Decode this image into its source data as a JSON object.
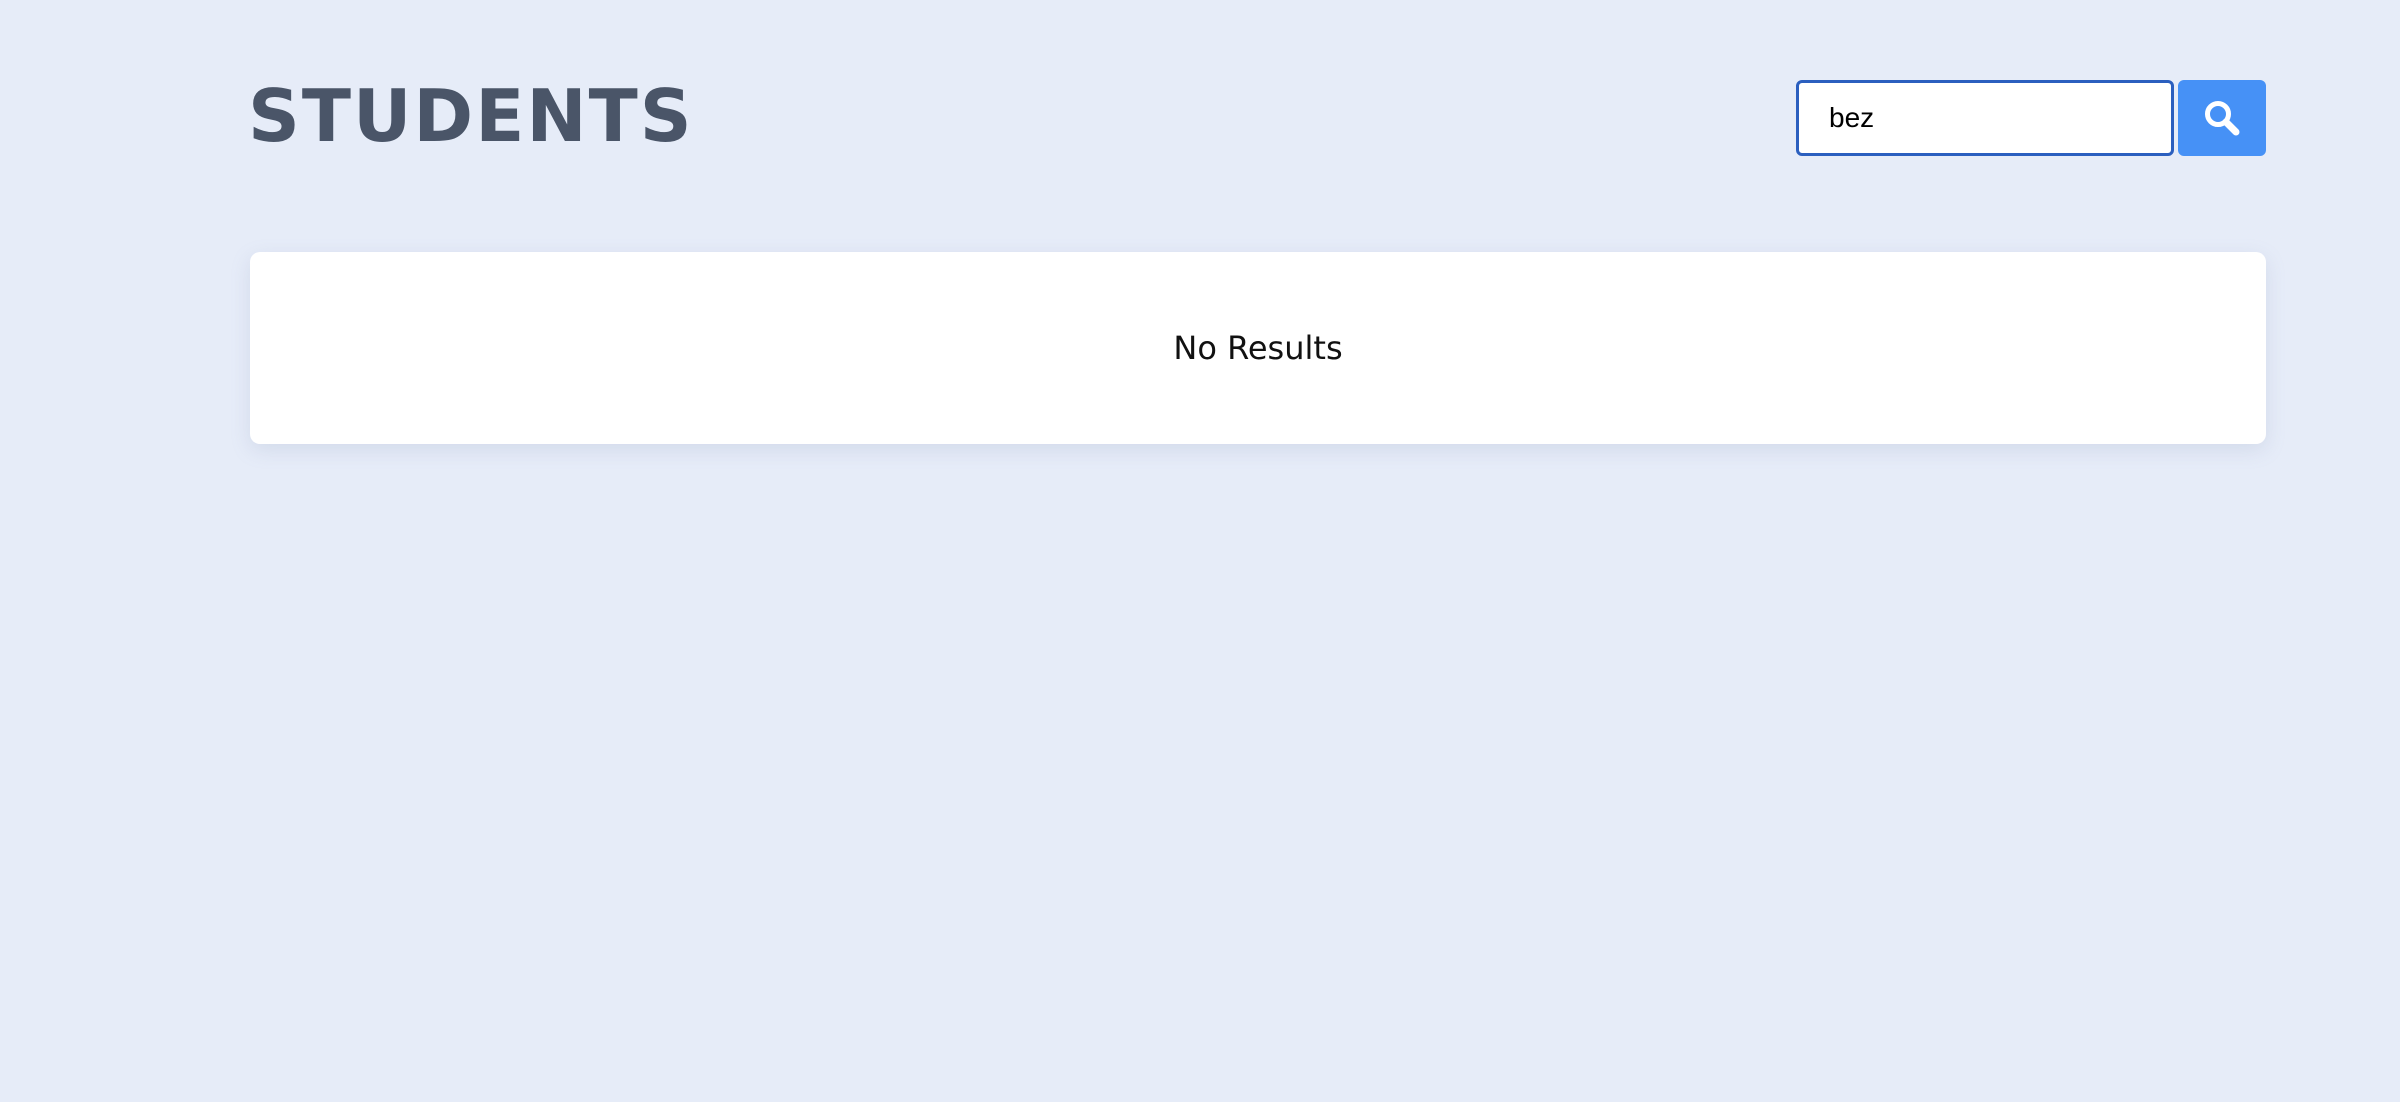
{
  "header": {
    "title": "STUDENTS"
  },
  "search": {
    "value": "bez",
    "icon": "search-icon"
  },
  "results": {
    "empty_message": "No Results"
  },
  "colors": {
    "background": "#e6ecf8",
    "title": "#4a5568",
    "accent": "#4691f6",
    "input_border": "#2b5fbf",
    "card": "#ffffff"
  }
}
